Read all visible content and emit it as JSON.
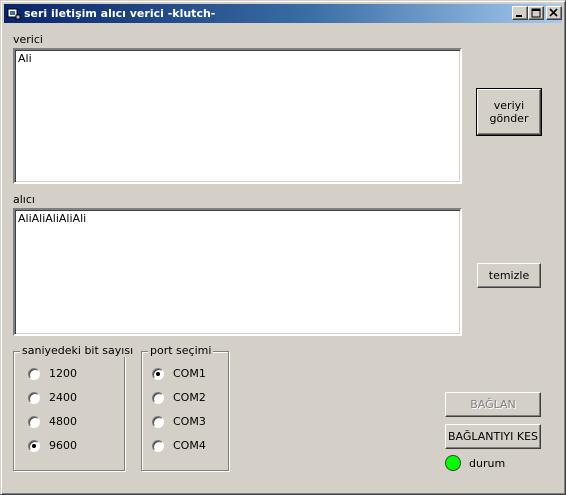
{
  "window": {
    "title": "seri iletişim alıcı verici -klutch-"
  },
  "sender": {
    "label": "verici",
    "text": "Ali"
  },
  "receiver": {
    "label": "alıcı",
    "text": "AliAliAliAliAli"
  },
  "buttons": {
    "send": "veriyi gönder",
    "clear": "temizle",
    "connect": "BAĞLAN",
    "disconnect": "BAĞLANTIYI KES"
  },
  "baud_group": {
    "title": "saniyedeki bit sayısı",
    "options": [
      "1200",
      "2400",
      "4800",
      "9600"
    ],
    "selected": "9600"
  },
  "port_group": {
    "title": "port seçimi",
    "options": [
      "COM1",
      "COM2",
      "COM3",
      "COM4"
    ],
    "selected": "COM1"
  },
  "status": {
    "label": "durum",
    "color": "#00ff00"
  }
}
